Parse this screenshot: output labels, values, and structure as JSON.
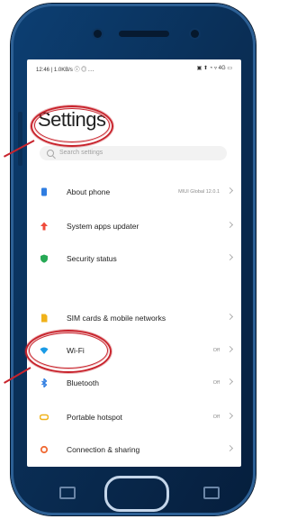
{
  "status_bar": {
    "left": "12:46 | 1.0KB/s ⓘ ◎ ⋯",
    "right": "▣ ⬆ ◔ ▿ 4G ▭"
  },
  "settings": {
    "title": "Settings",
    "search_placeholder": "Search settings",
    "items": [
      {
        "label": "About phone",
        "value": "MIUI Global 12.0.1",
        "icon": "phone-icon",
        "color": "#2f7de1"
      },
      {
        "label": "System apps updater",
        "value": "",
        "icon": "arrow-up-icon",
        "color": "#ef4b3b"
      },
      {
        "label": "Security status",
        "value": "",
        "icon": "shield-icon",
        "color": "#26a955"
      },
      {
        "label": "SIM cards & mobile networks",
        "value": "",
        "icon": "sim-icon",
        "color": "#f0b21a"
      },
      {
        "label": "Wi-Fi",
        "value": "Off",
        "icon": "wifi-icon",
        "color": "#1a9be6"
      },
      {
        "label": "Bluetooth",
        "value": "Off",
        "icon": "bluetooth-icon",
        "color": "#2f7de1"
      },
      {
        "label": "Portable hotspot",
        "value": "Off",
        "icon": "hotspot-icon",
        "color": "#f0b21a"
      },
      {
        "label": "Connection & sharing",
        "value": "",
        "icon": "share-icon",
        "color": "#f06a34"
      }
    ]
  },
  "colors": {
    "phone_body": "#0a2f57",
    "highlight": "#c8232c"
  }
}
